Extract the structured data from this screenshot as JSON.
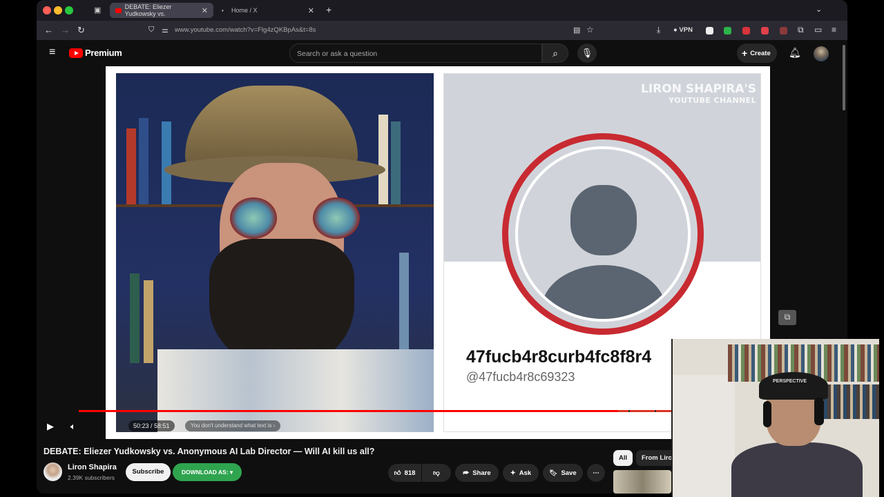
{
  "browser": {
    "tabs": [
      {
        "title": "DEBATE: Eliezer Yudkowsky vs.",
        "active": true
      },
      {
        "title": "Home / X",
        "active": false
      }
    ],
    "url": "www.youtube.com/watch?v=Flg4zQKBpAs&t=8s",
    "vpn_label": "VPN"
  },
  "youtube": {
    "brand": "Premium",
    "search_placeholder": "Search or ask a question",
    "create_label": "Create"
  },
  "video": {
    "watermark_line1": "LIRON SHAPIRA'S",
    "watermark_line2": "YOUTUBE CHANNEL",
    "profile_name": "47fucb4r8curb4fc8f8r4",
    "profile_handle": "@47fucb4r8c69323",
    "time": "50:23 / 58:51",
    "chapter": "You don't understand what text is",
    "progress": 0.856,
    "ccap_text": "PERSPECTIVE"
  },
  "meta": {
    "title": "DEBATE: Eliezer Yudkowsky vs. Anonymous AI Lab Director — Will AI kill us all?",
    "channel": "Liron Shapira",
    "subscribers": "2.39K subscribers",
    "subscribe_label": "Subscribe",
    "download_label": "DOWNLOAD AS: ▾",
    "likes": "818",
    "share_label": "Share",
    "ask_label": "Ask",
    "save_label": "Save",
    "chips": [
      "All",
      "From Liron"
    ]
  },
  "colors": {
    "accent": "#ff0000",
    "download": "#2fa44f",
    "ring": "#c82a31"
  }
}
